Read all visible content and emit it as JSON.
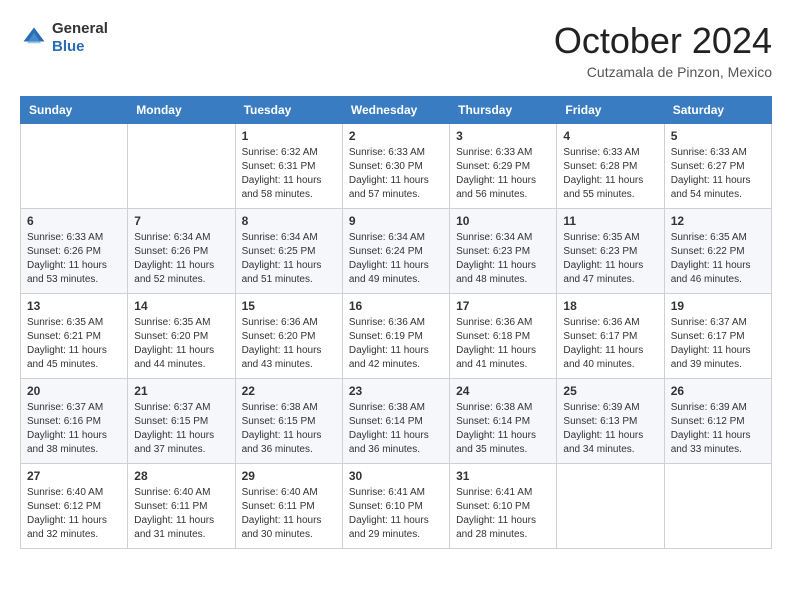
{
  "header": {
    "logo_line1": "General",
    "logo_line2": "Blue",
    "month": "October 2024",
    "location": "Cutzamala de Pinzon, Mexico"
  },
  "days_of_week": [
    "Sunday",
    "Monday",
    "Tuesday",
    "Wednesday",
    "Thursday",
    "Friday",
    "Saturday"
  ],
  "weeks": [
    [
      {
        "day": "",
        "detail": ""
      },
      {
        "day": "",
        "detail": ""
      },
      {
        "day": "1",
        "detail": "Sunrise: 6:32 AM\nSunset: 6:31 PM\nDaylight: 11 hours and 58 minutes."
      },
      {
        "day": "2",
        "detail": "Sunrise: 6:33 AM\nSunset: 6:30 PM\nDaylight: 11 hours and 57 minutes."
      },
      {
        "day": "3",
        "detail": "Sunrise: 6:33 AM\nSunset: 6:29 PM\nDaylight: 11 hours and 56 minutes."
      },
      {
        "day": "4",
        "detail": "Sunrise: 6:33 AM\nSunset: 6:28 PM\nDaylight: 11 hours and 55 minutes."
      },
      {
        "day": "5",
        "detail": "Sunrise: 6:33 AM\nSunset: 6:27 PM\nDaylight: 11 hours and 54 minutes."
      }
    ],
    [
      {
        "day": "6",
        "detail": "Sunrise: 6:33 AM\nSunset: 6:26 PM\nDaylight: 11 hours and 53 minutes."
      },
      {
        "day": "7",
        "detail": "Sunrise: 6:34 AM\nSunset: 6:26 PM\nDaylight: 11 hours and 52 minutes."
      },
      {
        "day": "8",
        "detail": "Sunrise: 6:34 AM\nSunset: 6:25 PM\nDaylight: 11 hours and 51 minutes."
      },
      {
        "day": "9",
        "detail": "Sunrise: 6:34 AM\nSunset: 6:24 PM\nDaylight: 11 hours and 49 minutes."
      },
      {
        "day": "10",
        "detail": "Sunrise: 6:34 AM\nSunset: 6:23 PM\nDaylight: 11 hours and 48 minutes."
      },
      {
        "day": "11",
        "detail": "Sunrise: 6:35 AM\nSunset: 6:23 PM\nDaylight: 11 hours and 47 minutes."
      },
      {
        "day": "12",
        "detail": "Sunrise: 6:35 AM\nSunset: 6:22 PM\nDaylight: 11 hours and 46 minutes."
      }
    ],
    [
      {
        "day": "13",
        "detail": "Sunrise: 6:35 AM\nSunset: 6:21 PM\nDaylight: 11 hours and 45 minutes."
      },
      {
        "day": "14",
        "detail": "Sunrise: 6:35 AM\nSunset: 6:20 PM\nDaylight: 11 hours and 44 minutes."
      },
      {
        "day": "15",
        "detail": "Sunrise: 6:36 AM\nSunset: 6:20 PM\nDaylight: 11 hours and 43 minutes."
      },
      {
        "day": "16",
        "detail": "Sunrise: 6:36 AM\nSunset: 6:19 PM\nDaylight: 11 hours and 42 minutes."
      },
      {
        "day": "17",
        "detail": "Sunrise: 6:36 AM\nSunset: 6:18 PM\nDaylight: 11 hours and 41 minutes."
      },
      {
        "day": "18",
        "detail": "Sunrise: 6:36 AM\nSunset: 6:17 PM\nDaylight: 11 hours and 40 minutes."
      },
      {
        "day": "19",
        "detail": "Sunrise: 6:37 AM\nSunset: 6:17 PM\nDaylight: 11 hours and 39 minutes."
      }
    ],
    [
      {
        "day": "20",
        "detail": "Sunrise: 6:37 AM\nSunset: 6:16 PM\nDaylight: 11 hours and 38 minutes."
      },
      {
        "day": "21",
        "detail": "Sunrise: 6:37 AM\nSunset: 6:15 PM\nDaylight: 11 hours and 37 minutes."
      },
      {
        "day": "22",
        "detail": "Sunrise: 6:38 AM\nSunset: 6:15 PM\nDaylight: 11 hours and 36 minutes."
      },
      {
        "day": "23",
        "detail": "Sunrise: 6:38 AM\nSunset: 6:14 PM\nDaylight: 11 hours and 36 minutes."
      },
      {
        "day": "24",
        "detail": "Sunrise: 6:38 AM\nSunset: 6:14 PM\nDaylight: 11 hours and 35 minutes."
      },
      {
        "day": "25",
        "detail": "Sunrise: 6:39 AM\nSunset: 6:13 PM\nDaylight: 11 hours and 34 minutes."
      },
      {
        "day": "26",
        "detail": "Sunrise: 6:39 AM\nSunset: 6:12 PM\nDaylight: 11 hours and 33 minutes."
      }
    ],
    [
      {
        "day": "27",
        "detail": "Sunrise: 6:40 AM\nSunset: 6:12 PM\nDaylight: 11 hours and 32 minutes."
      },
      {
        "day": "28",
        "detail": "Sunrise: 6:40 AM\nSunset: 6:11 PM\nDaylight: 11 hours and 31 minutes."
      },
      {
        "day": "29",
        "detail": "Sunrise: 6:40 AM\nSunset: 6:11 PM\nDaylight: 11 hours and 30 minutes."
      },
      {
        "day": "30",
        "detail": "Sunrise: 6:41 AM\nSunset: 6:10 PM\nDaylight: 11 hours and 29 minutes."
      },
      {
        "day": "31",
        "detail": "Sunrise: 6:41 AM\nSunset: 6:10 PM\nDaylight: 11 hours and 28 minutes."
      },
      {
        "day": "",
        "detail": ""
      },
      {
        "day": "",
        "detail": ""
      }
    ]
  ]
}
